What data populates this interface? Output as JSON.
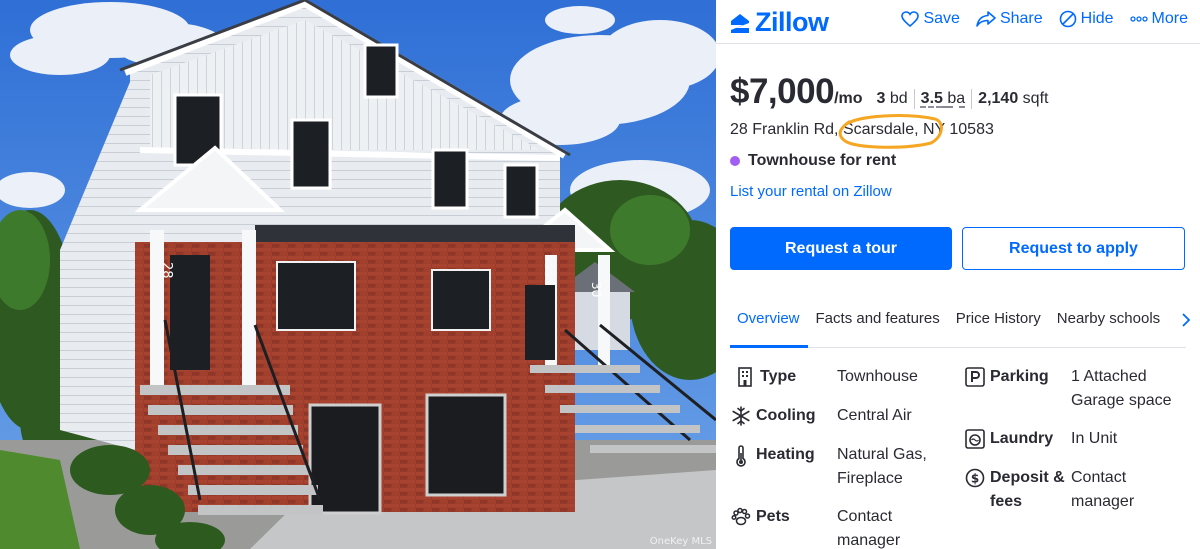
{
  "photo": {
    "house_number_left": "28",
    "house_number_right": "30",
    "watermark": "OneKey MLS"
  },
  "brand": {
    "name": "Zillow",
    "color": "#006aff"
  },
  "header_actions": [
    {
      "label": "Save",
      "icon": "heart-icon"
    },
    {
      "label": "Share",
      "icon": "share-icon"
    },
    {
      "label": "Hide",
      "icon": "hide-icon"
    },
    {
      "label": "More",
      "icon": "more-icon"
    }
  ],
  "listing": {
    "price": "$7,000",
    "price_suffix": "/mo",
    "beds_value": "3",
    "beds_unit": "bd",
    "baths_value": "3.5",
    "baths_unit": "ba",
    "sqft_value": "2,140",
    "sqft_unit": "sqft",
    "address_street": "28 Franklin Rd, ",
    "address_city": "Scarsdale",
    "address_rest": ", NY 10583",
    "status": "Townhouse for rent",
    "status_color": "#a25df3",
    "list_link": "List your rental on Zillow"
  },
  "buttons": {
    "request_tour": "Request a tour",
    "request_apply": "Request to apply"
  },
  "tabs": [
    "Overview",
    "Facts and features",
    "Price History",
    "Nearby schools"
  ],
  "facts": {
    "type": {
      "label": "Type",
      "value": "Townhouse",
      "icon": "building-icon"
    },
    "cooling": {
      "label": "Cooling",
      "value": "Central Air",
      "icon": "snowflake-icon"
    },
    "heating": {
      "label": "Heating",
      "value_line1": "Natural Gas,",
      "value_line2": "Fireplace",
      "icon": "thermometer-icon"
    },
    "pets": {
      "label": "Pets",
      "value_line1": "Contact",
      "value_line2": "manager",
      "icon": "paw-icon"
    },
    "parking": {
      "label": "Parking",
      "value_line1": "1 Attached",
      "value_line2": "Garage space",
      "icon": "parking-icon"
    },
    "laundry": {
      "label": "Laundry",
      "value": "In Unit",
      "icon": "washer-icon"
    },
    "deposit": {
      "label_line1": "Deposit &",
      "label_line2": "fees",
      "value_line1": "Contact",
      "value_line2": "manager",
      "icon": "dollar-icon"
    }
  },
  "highlight_color": "#f5a623"
}
